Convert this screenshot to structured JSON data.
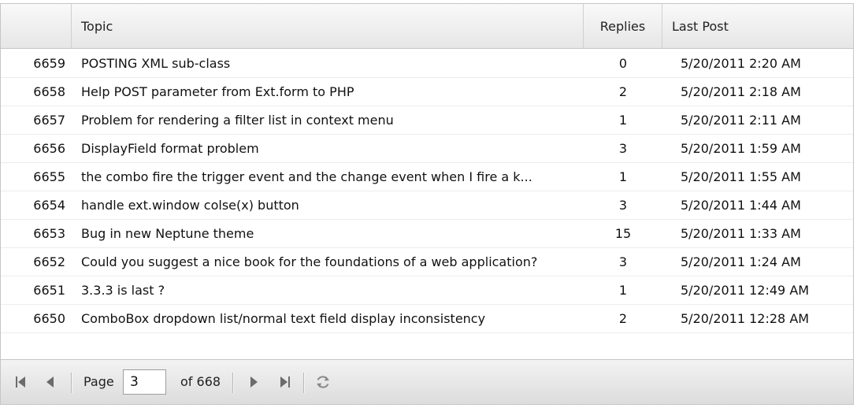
{
  "columns": {
    "id": "",
    "topic": "Topic",
    "replies": "Replies",
    "last_post": "Last Post"
  },
  "rows": [
    {
      "id": "6659",
      "topic": "POSTING XML sub-class",
      "replies": "0",
      "last_post": "5/20/2011 2:20 AM"
    },
    {
      "id": "6658",
      "topic": "Help POST parameter from Ext.form to PHP",
      "replies": "2",
      "last_post": "5/20/2011 2:18 AM"
    },
    {
      "id": "6657",
      "topic": "Problem for rendering a filter list in context menu",
      "replies": "1",
      "last_post": "5/20/2011 2:11 AM"
    },
    {
      "id": "6656",
      "topic": "DisplayField format problem",
      "replies": "3",
      "last_post": "5/20/2011 1:59 AM"
    },
    {
      "id": "6655",
      "topic": "the combo fire the trigger event and the change event when I fire a k...",
      "replies": "1",
      "last_post": "5/20/2011 1:55 AM"
    },
    {
      "id": "6654",
      "topic": "handle ext.window colse(x) button",
      "replies": "3",
      "last_post": "5/20/2011 1:44 AM"
    },
    {
      "id": "6653",
      "topic": "Bug in new Neptune theme",
      "replies": "15",
      "last_post": "5/20/2011 1:33 AM"
    },
    {
      "id": "6652",
      "topic": "Could you suggest a nice book for the foundations of a web application?",
      "replies": "3",
      "last_post": "5/20/2011 1:24 AM"
    },
    {
      "id": "6651",
      "topic": "3.3.3 is last ?",
      "replies": "1",
      "last_post": "5/20/2011 12:49 AM"
    },
    {
      "id": "6650",
      "topic": "ComboBox dropdown list/normal text field display inconsistency",
      "replies": "2",
      "last_post": "5/20/2011 12:28 AM"
    }
  ],
  "pager": {
    "page_label": "Page",
    "page_value": "3",
    "of_label": "of 668",
    "icons": [
      "first-page-icon",
      "prev-page-icon",
      "next-page-icon",
      "last-page-icon",
      "refresh-icon"
    ]
  },
  "colors": {
    "border": "#c5c5c5",
    "icon": "#6b6b6b"
  }
}
